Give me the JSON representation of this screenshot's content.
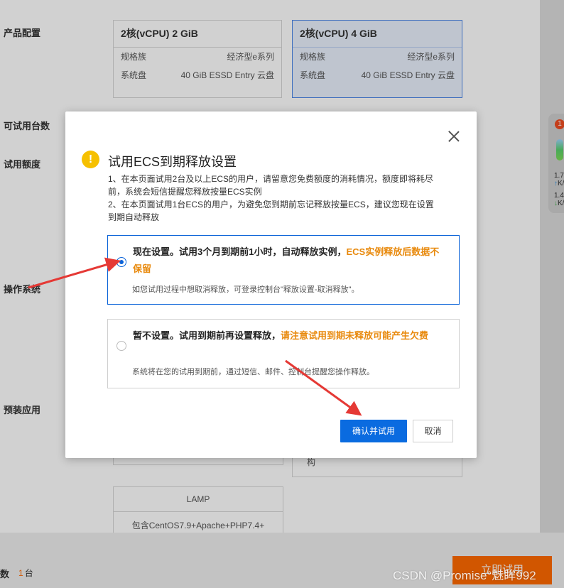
{
  "background": {
    "labels": {
      "product_config": "产品配置",
      "trial_count": "可试用台数",
      "trial_quota": "试用额度",
      "os": "操作系统",
      "preinstalled_apps": "预装应用"
    },
    "spec_cards": [
      {
        "title": "2核(vCPU) 2 GiB",
        "family_label": "规格族",
        "family_value": "经济型e系列",
        "disk_label": "系统盘",
        "disk_value": "40 GiB ESSD Entry 云盘",
        "selected": false
      },
      {
        "title": "2核(vCPU) 4 GiB",
        "family_label": "规格族",
        "family_value": "经济型e系列",
        "disk_label": "系统盘",
        "disk_value": "40 GiB ESSD Entry 云盘",
        "selected": true
      }
    ],
    "app_card": {
      "title": "LAMP",
      "desc": "包含CentOS7.9+Apache+PHP7.4+"
    },
    "right_app_partial": "构",
    "quantity_label": "数",
    "quantity_value": "1",
    "quantity_unit": "台",
    "buy_button": "立即试用",
    "float_widget": {
      "badge": "1",
      "stat1": "1.7",
      "stat1_unit": "K/s",
      "stat2": "1.4",
      "stat2_unit": "K/s"
    }
  },
  "modal": {
    "title": "试用ECS到期释放设置",
    "desc": [
      "1、在本页面试用2台及以上ECS的用户，请留意您免费额度的消耗情况，额度即将耗尽前，系统会短信提醒您释放按量ECS实例",
      "2、在本页面试用1台ECS的用户，为避免您到期前忘记释放按量ECS，建议您现在设置到期自动释放"
    ],
    "option_now": {
      "main": "现在设置。试用3个月到期前1小时，自动释放实例，",
      "warn": "ECS实例释放后数据不保留",
      "sub": "如您试用过程中想取消释放，可登录控制台\"释放设置-取消释放\"。",
      "selected": true
    },
    "option_later": {
      "main": "暂不设置。试用到期前再设置释放，",
      "warn": "请注意试用到期未释放可能产生欠费",
      "sub": "系统将在您的试用到期前，通过短信、邮件、控制台提醒您操作释放。",
      "selected": false
    },
    "confirm_button": "确认并试用",
    "cancel_button": "取消"
  },
  "watermark": "CSDN @Promise°魅眸992",
  "colors": {
    "primary_blue": "#0a6be0",
    "warn_orange": "#e8890c",
    "arrow_red": "#e53935",
    "buy_orange": "#ff6a00"
  }
}
